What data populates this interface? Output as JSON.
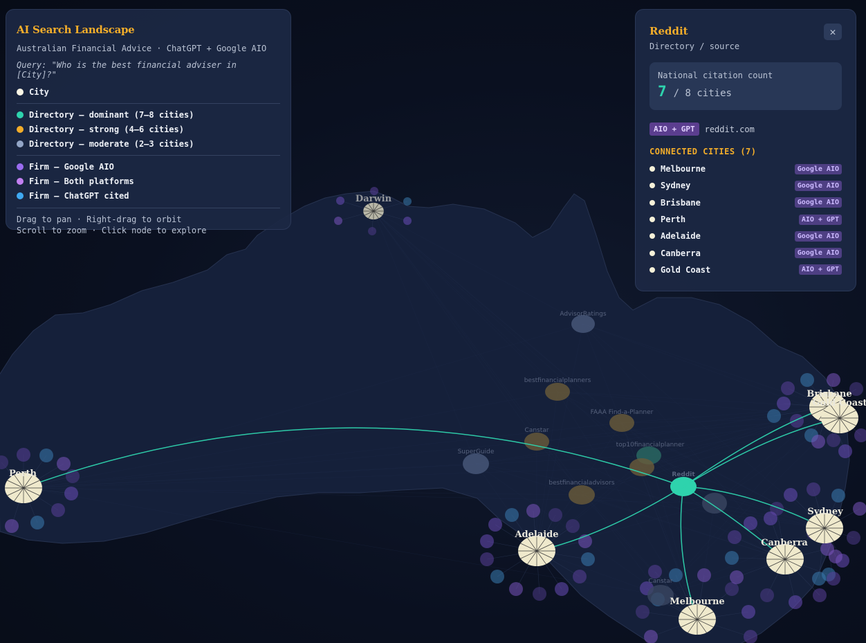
{
  "legend": {
    "title": "AI Search Landscape",
    "subtitle": "Australian Financial Advice · ChatGPT + Google AIO",
    "query": "Query: \"Who is the best financial adviser in [City]?\"",
    "items_city": [
      {
        "label": "City",
        "color": "#fbf6e6"
      }
    ],
    "items_directory": [
      {
        "label": "Directory — dominant (7–8 cities)",
        "color": "#2ed3ad"
      },
      {
        "label": "Directory — strong (4–6 cities)",
        "color": "#f3ad2a"
      },
      {
        "label": "Directory — moderate (2–3 cities)",
        "color": "#93a6c7"
      }
    ],
    "items_firm": [
      {
        "label": "Firm — Google AIO",
        "color": "#9a6cf0"
      },
      {
        "label": "Firm — Both platforms",
        "color": "#c280f2"
      },
      {
        "label": "Firm — ChatGPT cited",
        "color": "#3fa9f2"
      }
    ],
    "help_line1": "Drag to pan · Right-drag to orbit",
    "help_line2": "Scroll to zoom · Click node to explore"
  },
  "detail": {
    "title": "Reddit",
    "type": "Directory / source",
    "count_label": "National citation count",
    "count_value": "7",
    "count_of": "/ 8 cities",
    "platform_tag": "AIO + GPT",
    "domain": "reddit.com",
    "connected_heading": "CONNECTED CITIES (7)",
    "close_icon": "close-icon",
    "cities": [
      {
        "name": "Melbourne",
        "tag": "Google AIO"
      },
      {
        "name": "Sydney",
        "tag": "Google AIO"
      },
      {
        "name": "Brisbane",
        "tag": "Google AIO"
      },
      {
        "name": "Perth",
        "tag": "AIO + GPT"
      },
      {
        "name": "Adelaide",
        "tag": "Google AIO"
      },
      {
        "name": "Canberra",
        "tag": "Google AIO"
      },
      {
        "name": "Gold Coast",
        "tag": "AIO + GPT"
      }
    ]
  },
  "map": {
    "city_labels": [
      "Darwin",
      "Perth",
      "Adelaide",
      "Melbourne",
      "Canberra",
      "Sydney",
      "Brisbane",
      "Gold Coast"
    ],
    "node_labels": [
      "AdvisorRatings",
      "bestfinancialplanners",
      "FAAA Find-a-Planner",
      "Canstar",
      "SuperGuide",
      "top10financialplanner",
      "Reddit",
      "bestfinancialadvisors",
      "Canstar"
    ],
    "colors": {
      "link": "#2ed3ad",
      "city": "#efe9cc",
      "land": "#16213a"
    }
  }
}
